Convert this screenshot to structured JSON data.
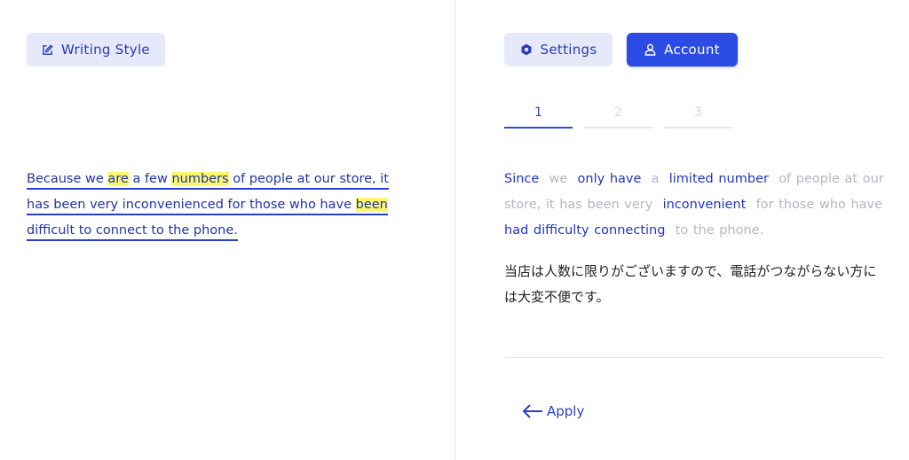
{
  "toolbar_left": {
    "writing_style_label": "Writing Style"
  },
  "toolbar_right": {
    "settings_label": "Settings",
    "account_label": "Account"
  },
  "input": {
    "segments": [
      {
        "text": "Because we ",
        "highlight": false
      },
      {
        "text": "are",
        "highlight": true
      },
      {
        "text": " a few ",
        "highlight": false
      },
      {
        "text": "numbers",
        "highlight": true
      },
      {
        "text": " of people at our store, it has been very inconvenienced for those who have ",
        "highlight": false
      },
      {
        "text": "been",
        "highlight": true
      },
      {
        "text": " difficult to connect to the phone.",
        "highlight": false
      }
    ]
  },
  "steps": {
    "tab_1": "1",
    "tab_2": "2",
    "tab_3": "3",
    "active": "1"
  },
  "suggestion": {
    "segments": [
      {
        "text": "Since",
        "emphasis": true
      },
      {
        "text": "we",
        "emphasis": false
      },
      {
        "text": "only have",
        "emphasis": true
      },
      {
        "text": "a",
        "emphasis": false
      },
      {
        "text": "limited number",
        "emphasis": true
      },
      {
        "text": "of people at our store, it has been very",
        "emphasis": false
      },
      {
        "text": "inconvenient",
        "emphasis": true
      },
      {
        "text": "for those who have",
        "emphasis": false
      },
      {
        "text": "had difficulty connecting",
        "emphasis": true
      },
      {
        "text": "to the phone.",
        "emphasis": false
      }
    ]
  },
  "translation": "当店は人数に限りがございますので、電話がつながらない方には大変不便です。",
  "actions": {
    "apply_label": "Apply"
  },
  "colors": {
    "primary": "#2b4be4",
    "highlight": "#fbf86d",
    "muted_text": "#b3b7c3",
    "button_light": "#e6e9fa"
  },
  "icons": {
    "writing_style": "edit-icon",
    "settings": "gear-icon",
    "account": "user-icon",
    "apply": "arrow-left-icon"
  }
}
